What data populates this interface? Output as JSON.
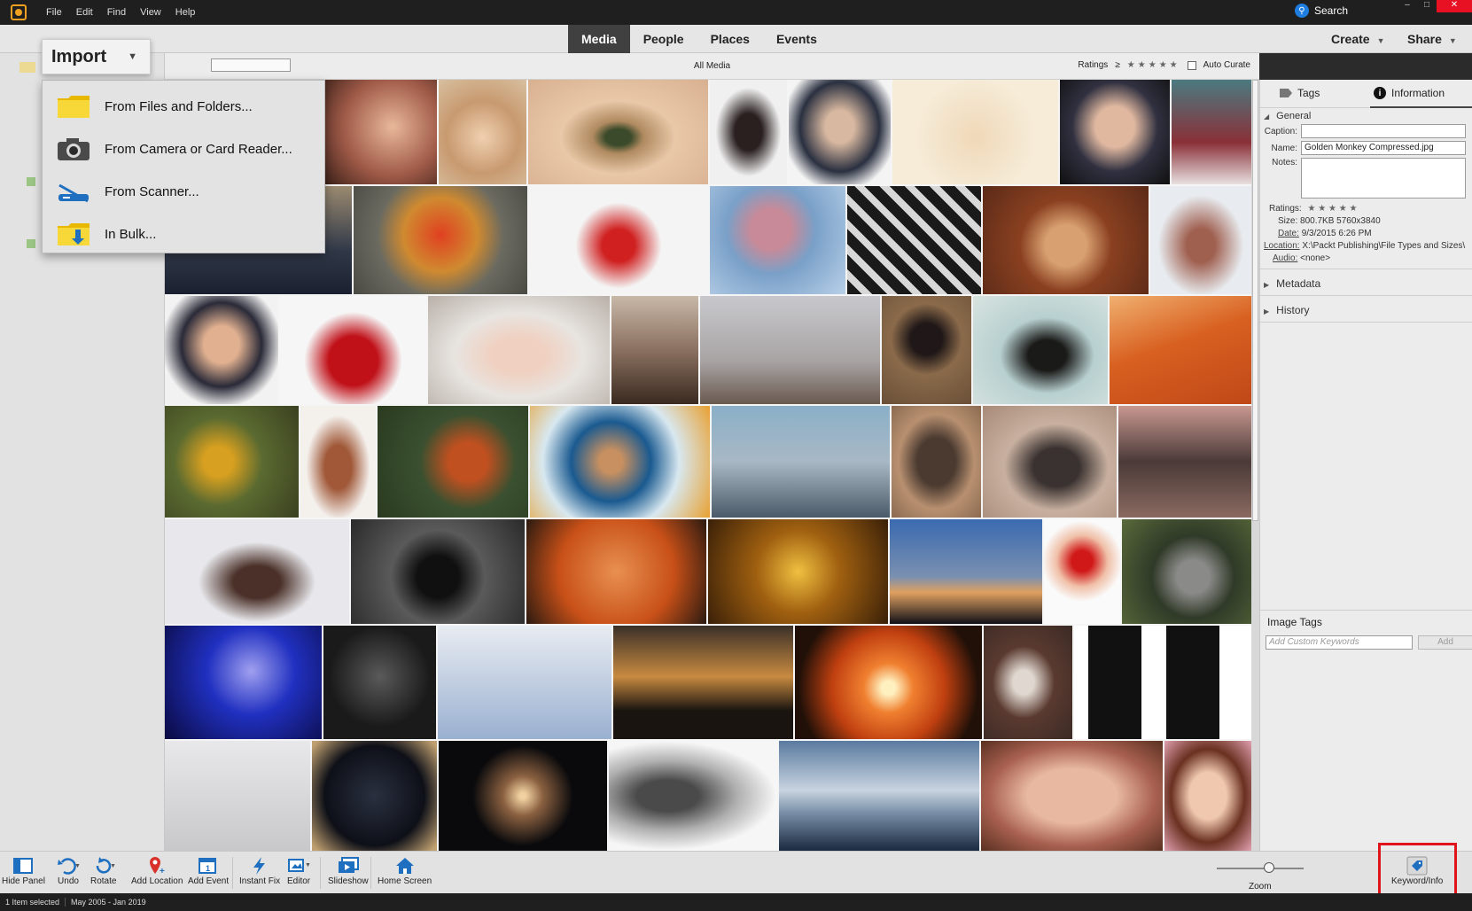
{
  "menubar": {
    "items": [
      "File",
      "Edit",
      "Find",
      "View",
      "Help"
    ],
    "search_label": "Search"
  },
  "tabs": {
    "items": [
      "Media",
      "People",
      "Places",
      "Events"
    ],
    "active": "Media",
    "create_label": "Create",
    "share_label": "Share"
  },
  "filter_bar": {
    "title": "All Media",
    "ratings_label": "Ratings",
    "ratings_op": "≥",
    "stars": "★★★★★",
    "auto_curate_label": "Auto Curate"
  },
  "import_menu": {
    "button_label": "Import",
    "items": [
      {
        "label": "From Files and Folders...",
        "icon": "folder-icon"
      },
      {
        "label": "From Camera or Card Reader...",
        "icon": "camera-icon"
      },
      {
        "label": "From Scanner...",
        "icon": "scanner-icon"
      },
      {
        "label": "In Bulk...",
        "icon": "bulk-folder-icon"
      }
    ]
  },
  "right_panel": {
    "tabs": [
      "Tags",
      "Information"
    ],
    "active_tab": "Information",
    "general": {
      "heading": "General",
      "caption_label": "Caption:",
      "caption_value": "",
      "name_label": "Name:",
      "name_value": "Golden Monkey Compressed.jpg",
      "notes_label": "Notes:",
      "notes_value": "",
      "ratings_label": "Ratings:",
      "ratings_stars": "★ ★ ★ ★ ★",
      "size_label": "Size:",
      "size_value": "800.7KB  5760x3840",
      "date_label": "Date:",
      "date_value": "9/3/2015 6:26 PM",
      "location_label": "Location:",
      "location_value": "X:\\Packt Publishing\\File Types and Sizes\\",
      "audio_label": "Audio:",
      "audio_value": "<none>"
    },
    "metadata_heading": "Metadata",
    "history_heading": "History",
    "image_tags": {
      "heading": "Image Tags",
      "placeholder": "Add Custom Keywords",
      "add_label": "Add"
    }
  },
  "toolbar": {
    "buttons": [
      {
        "label": "Hide Panel",
        "icon": "panel-icon"
      },
      {
        "label": "Undo",
        "icon": "undo-icon"
      },
      {
        "label": "Rotate",
        "icon": "rotate-icon"
      },
      {
        "label": "Add Location",
        "icon": "map-pin-icon"
      },
      {
        "label": "Add Event",
        "icon": "calendar-icon"
      },
      {
        "label": "Instant Fix",
        "icon": "lightning-icon"
      },
      {
        "label": "Editor",
        "icon": "editor-icon"
      },
      {
        "label": "Slideshow",
        "icon": "slideshow-icon"
      },
      {
        "label": "Home Screen",
        "icon": "home-icon"
      }
    ],
    "zoom_label": "Zoom",
    "zoom_level": 0.6,
    "keyword_info_label": "Keyword/Info"
  },
  "status": {
    "selection": "1 Item selected",
    "date_range": "May 2005 - Jan 2019"
  },
  "colors": {
    "accent_blue": "#1f7de0",
    "highlight_red": "#e0141b",
    "dark_chrome": "#1f1f1f"
  }
}
